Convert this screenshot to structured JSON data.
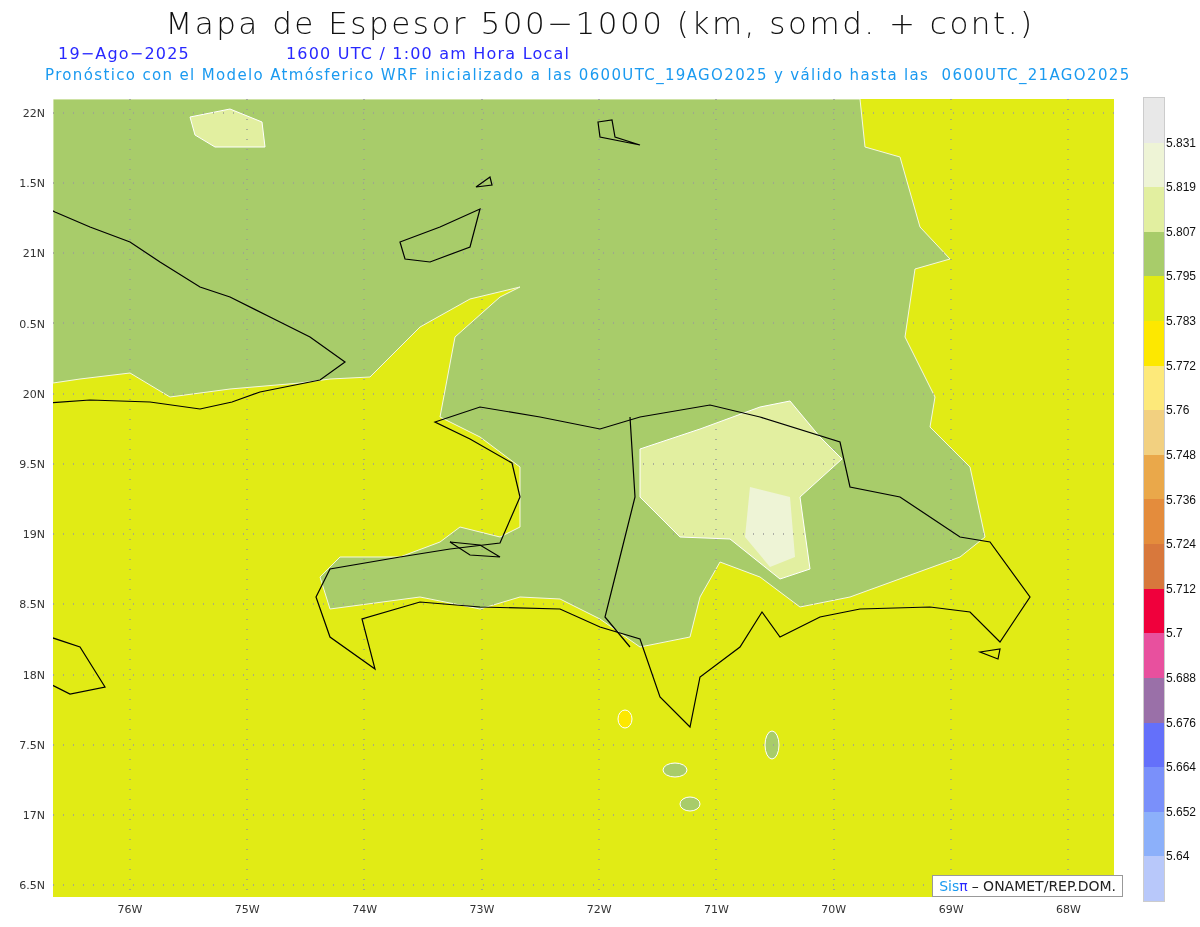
{
  "title": "Mapa de Espesor 500−1000 (km, somd. + cont.)",
  "date": "19−Ago−2025",
  "time": "1600 UTC / 1:00 am Hora Local",
  "subtitle": "Pronóstico con el Modelo Atmósferico WRF inicializado a las 0600UTC_19AGO2025 y válido hasta las  0600UTC_21AGO2025",
  "y_axis": [
    "22N",
    "1.5N",
    "21N",
    "0.5N",
    "20N",
    "9.5N",
    "19N",
    "8.5N",
    "18N",
    "7.5N",
    "17N",
    "6.5N"
  ],
  "x_axis": [
    "76W",
    "75W",
    "74W",
    "73W",
    "72W",
    "71W",
    "70W",
    "69W",
    "68W"
  ],
  "legend": [
    {
      "color": "#e8e8e8",
      "label": "5.831"
    },
    {
      "color": "#eef4d6",
      "label": "5.819"
    },
    {
      "color": "#e2efa0",
      "label": "5.807"
    },
    {
      "color": "#a8cc6a",
      "label": "5.795"
    },
    {
      "color": "#e1eb15",
      "label": "5.783"
    },
    {
      "color": "#fde800",
      "label": "5.772"
    },
    {
      "color": "#fde97a",
      "label": "5.76"
    },
    {
      "color": "#f2d080",
      "label": "5.748"
    },
    {
      "color": "#eaa84a",
      "label": "5.736"
    },
    {
      "color": "#e48c3c",
      "label": "5.724"
    },
    {
      "color": "#d8783c",
      "label": "5.712"
    },
    {
      "color": "#f0003c",
      "label": "5.7"
    },
    {
      "color": "#e8509e",
      "label": "5.688"
    },
    {
      "color": "#9a70a8",
      "label": "5.676"
    },
    {
      "color": "#6470fa",
      "label": "5.664"
    },
    {
      "color": "#7a90fa",
      "label": "5.652"
    },
    {
      "color": "#8cb0fa",
      "label": "5.64"
    },
    {
      "color": "#b8c8fa"
    }
  ],
  "credit": {
    "brand": "Sis",
    "symbol": "π",
    "text": "– ONAMET/REP.DOM."
  }
}
